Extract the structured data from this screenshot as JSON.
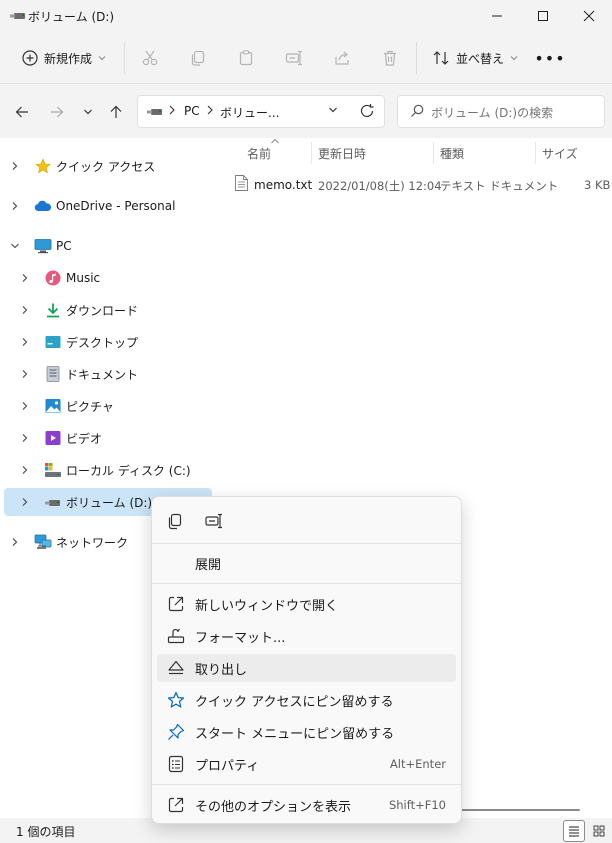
{
  "window": {
    "title": "ボリューム (D:)"
  },
  "toolbar": {
    "new_label": "新規作成",
    "sort_label": "並べ替え",
    "more_label": "•••"
  },
  "address": {
    "path": [
      "PC",
      "ボリュー..."
    ],
    "search_placeholder": "ボリューム (D:)の検索"
  },
  "nav": {
    "items": [
      {
        "label": "クイック アクセス",
        "icon": "star-icon"
      },
      {
        "label": "OneDrive - Personal",
        "icon": "cloud-icon"
      },
      {
        "label": "PC",
        "icon": "monitor-icon"
      },
      {
        "label": "Music",
        "icon": "music-icon"
      },
      {
        "label": "ダウンロード",
        "icon": "download-icon"
      },
      {
        "label": "デスクトップ",
        "icon": "desktop-icon"
      },
      {
        "label": "ドキュメント",
        "icon": "document-icon"
      },
      {
        "label": "ピクチャ",
        "icon": "picture-icon"
      },
      {
        "label": "ビデオ",
        "icon": "video-icon"
      },
      {
        "label": "ローカル ディスク (C:)",
        "icon": "local-disk-icon"
      },
      {
        "label": "ボリューム (D:)",
        "icon": "usb-drive-icon"
      },
      {
        "label": "ネットワーク",
        "icon": "network-icon"
      }
    ]
  },
  "files": {
    "columns": [
      "名前",
      "更新日時",
      "種類",
      "サイズ"
    ],
    "rows": [
      {
        "name": "memo.txt",
        "modified": "2022/01/08(土) 12:04",
        "type": "テキスト ドキュメント",
        "size": "3 KB"
      }
    ]
  },
  "status": {
    "count": "1 個の項目"
  },
  "context_menu": {
    "items": [
      {
        "label": "展開",
        "icon": "",
        "shortcut": ""
      },
      {
        "label": "新しいウィンドウで開く",
        "icon": "open-new-window-icon",
        "shortcut": ""
      },
      {
        "label": "フォーマット...",
        "icon": "format-icon",
        "shortcut": ""
      },
      {
        "label": "取り出し",
        "icon": "eject-icon",
        "shortcut": ""
      },
      {
        "label": "クイック アクセスにピン留めする",
        "icon": "star-outline-icon",
        "shortcut": ""
      },
      {
        "label": "スタート メニューにピン留めする",
        "icon": "pin-icon",
        "shortcut": ""
      },
      {
        "label": "プロパティ",
        "icon": "properties-icon",
        "shortcut": "Alt+Enter"
      },
      {
        "label": "その他のオプションを表示",
        "icon": "more-options-icon",
        "shortcut": "Shift+F10"
      }
    ]
  },
  "colors": {
    "accent": "#0067c0",
    "selection": "#cce4f7"
  }
}
